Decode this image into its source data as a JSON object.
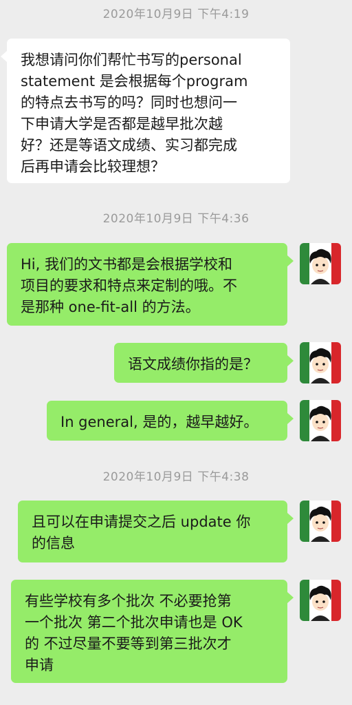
{
  "timestamps": [
    "2020年10月9日 下午4:19",
    "2020年10月9日 下午4:36",
    "2020年10月9日 下午4:38"
  ],
  "messages": [
    {
      "side": "incoming",
      "text": "我想请问你们帮忙书写的personal\nstatement 是会根据每个program\n的特点去书写的吗？同时也想问一\n下申请大学是否都是越早批次越\n好？还是等语文成绩、实习都完成\n后再申请会比较理想？"
    },
    {
      "side": "outgoing",
      "text": "Hi, 我们的文书都是会根据学校和\n项目的要求和特点来定制的哦。不\n是那种 one-fit-all 的方法。"
    },
    {
      "side": "outgoing",
      "text": "语文成绩你指的是？"
    },
    {
      "side": "outgoing",
      "text": "In general, 是的，越早越好。"
    },
    {
      "side": "outgoing",
      "text": "且可以在申请提交之后 update 你\n的信息"
    },
    {
      "side": "outgoing",
      "text": "有些学校有多个批次 不必要抢第\n一个批次 第二个批次申请也是 OK\n的 不过尽量不要等到第三批次才\n申请"
    }
  ],
  "avatar_icon": "cartoon-boy-avatar-icon",
  "colors": {
    "background": "#ededed",
    "outgoing_bubble": "#95ec69",
    "incoming_bubble": "#ffffff",
    "timestamp": "#9a9a9a"
  }
}
